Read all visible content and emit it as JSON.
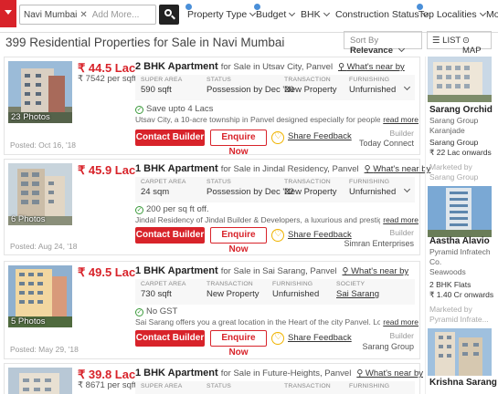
{
  "nav": {
    "location_chip": "Navi Mumbai",
    "add_more_placeholder": "Add More...",
    "filters": [
      "Property Type",
      "Budget",
      "BHK",
      "Construction Status",
      "Top Localities",
      "Mo"
    ]
  },
  "results": {
    "title": "399 Residential Properties for Sale in Navi Mumbai",
    "sort_prefix": "Sort By",
    "sort_value": "Relevance",
    "view_list": "LIST",
    "view_map": "MAP"
  },
  "listings": [
    {
      "price": "₹ 44.5 Lac",
      "price_per_sqft": "₹ 7542 per sqft",
      "photos": "23 Photos",
      "posted": "Posted: Oct 16, '18",
      "bhk": "2 BHK Apartment",
      "title_rest": "for Sale in Utsav City, Panvel",
      "near": "What's near by",
      "specs": [
        {
          "label": "SUPER AREA",
          "value": "590 sqft"
        },
        {
          "label": "STATUS",
          "value": "Possession by Dec '20"
        },
        {
          "label": "TRANSACTION",
          "value": "New Property"
        },
        {
          "label": "FURNISHING",
          "value": "Unfurnished"
        }
      ],
      "offer": "Save upto 4 Lacs",
      "desc": "Utsav City, a 10-acre township in Panvel designed especially for people looking for the best deals",
      "read_more": "read more",
      "contact": "Contact Builder",
      "enquire": "Enquire Now",
      "share": "Share Feedback",
      "builder_label": "Builder",
      "builder": "Today Connect"
    },
    {
      "price": "₹ 45.9 Lac",
      "price_per_sqft": "",
      "photos": "6 Photos",
      "posted": "Posted: Aug 24, '18",
      "bhk": "1 BHK Apartment",
      "title_rest": "for Sale in Jindal Residency, Panvel",
      "near": "What's near by",
      "specs": [
        {
          "label": "CARPET AREA",
          "value": "24 sqm"
        },
        {
          "label": "STATUS",
          "value": "Possession by Dec '22"
        },
        {
          "label": "TRANSACTION",
          "value": "New Property"
        },
        {
          "label": "FURNISHING",
          "value": "Unfurnished"
        }
      ],
      "offer": "200 per sq ft off.",
      "desc": "Jindal Residency of Jindal Builder & Developers, a luxurious and prestigious residential developm",
      "read_more": "read more",
      "contact": "Contact Builder",
      "enquire": "Enquire Now",
      "share": "Share Feedback",
      "builder_label": "Builder",
      "builder": "Simran Enterprises"
    },
    {
      "price": "₹ 49.5 Lac",
      "price_per_sqft": "",
      "photos": "5 Photos",
      "posted": "Posted: May 29, '18",
      "bhk": "1 BHK Apartment",
      "title_rest": "for Sale in Sai Sarang, Panvel",
      "near": "What's near by",
      "specs": [
        {
          "label": "CARPET AREA",
          "value": "730 sqft"
        },
        {
          "label": "TRANSACTION",
          "value": "New Property"
        },
        {
          "label": "FURNISHING",
          "value": "Unfurnished"
        },
        {
          "label": "SOCIETY",
          "value": "Sai Sarang"
        }
      ],
      "offer": "No GST",
      "desc": "Sai Sarang offers you a great location in the Heart of the city Panvel. Located on M.G. Road it is s",
      "read_more": "read more",
      "contact": "Contact Builder",
      "enquire": "Enquire Now",
      "share": "Share Feedback",
      "builder_label": "Builder",
      "builder": "Sarang Group"
    },
    {
      "price": "₹ 39.8 Lac",
      "price_per_sqft": "₹ 8671 per sqft",
      "bhk": "1 BHK Apartment",
      "title_rest": "for Sale in Future-Heights, Panvel",
      "near": "What's near by",
      "specs": [
        {
          "label": "SUPER AREA",
          "value": ""
        },
        {
          "label": "STATUS",
          "value": ""
        },
        {
          "label": "TRANSACTION",
          "value": ""
        },
        {
          "label": "FURNISHING",
          "value": ""
        }
      ]
    }
  ],
  "sidebar": [
    {
      "name": "Sarang Orchid",
      "lines": [
        "Sarang Group",
        "Karanjade"
      ],
      "bhk": "Sarang Group",
      "price": "₹ 22 Lac onwards",
      "marketed": "Marketed by",
      "marketed_by": "Sarang Group"
    },
    {
      "name": "Aastha Alavio",
      "lines": [
        "Pyramid Infratech",
        "Co.",
        "Seawoods"
      ],
      "bhk": "2 BHK Flats",
      "price": "₹ 1.40 Cr onwards",
      "marketed": "Marketed by",
      "marketed_by": "Pyramid Infrate..."
    },
    {
      "name": "Krishna Sarang"
    }
  ],
  "colors": {
    "accent": "#d8232a",
    "badge": "#4a8fd8",
    "offer_green": "#3a9a3a"
  }
}
